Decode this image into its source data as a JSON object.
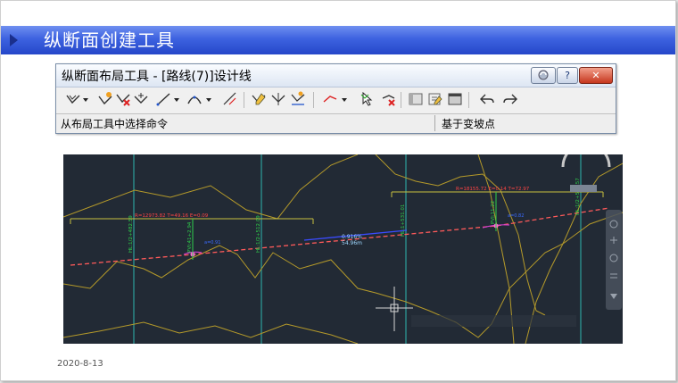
{
  "header": {
    "title": "纵断面创建工具"
  },
  "tool_window": {
    "title": "纵断面布局工具 - [路线(7)]设计线",
    "status_left": "从布局工具中选择命令",
    "status_right": "基于变坡点",
    "icons": [
      "draw-tangents-icon",
      "dropdown-arrow-icon",
      "insert-pvi-icon",
      "delete-pvi-icon",
      "move-pvi-icon",
      "draw-fixed-line-icon",
      "dropdown-arrow-icon",
      "draw-curve-icon",
      "dropdown-arrow-icon",
      "convert-entities-icon",
      "insert-pvis-tabular-icon",
      "raise-lower-pvis-icon",
      "copy-pvis-icon",
      "sub-entity-icon",
      "dropdown-arrow-icon",
      "select-pvi-icon",
      "delete-entity-icon",
      "entity-editor-icon",
      "pvi-editor-icon",
      "grid-view-icon",
      "undo-icon",
      "redo-icon"
    ]
  },
  "cad": {
    "annot_left": "R=12973.82  T=49.16  E=0.09",
    "annot_right": "R=18155.72  E=0.14  T=72.97",
    "grade_pct": "0.916%",
    "grade_len": "54.96m",
    "station_labels": [
      "HL:1/2+482.59",
      "PVI:41+2.94",
      "HL:1/2+512.09",
      "HL:1+531.01",
      "PVI:11.22",
      "HL:1/2+573.57"
    ],
    "small_labels": [
      "a=0.91",
      "a=0.82"
    ]
  },
  "footer": {
    "date": "2020-8-13"
  },
  "colors": {
    "header": "#2f52d6",
    "cad_bg": "#222a35",
    "terrain": "#b59a2a",
    "grid": "#2fb7b0",
    "profile": "#ff5a5a",
    "annot": "#c8c040",
    "label": "#2fd04a"
  }
}
